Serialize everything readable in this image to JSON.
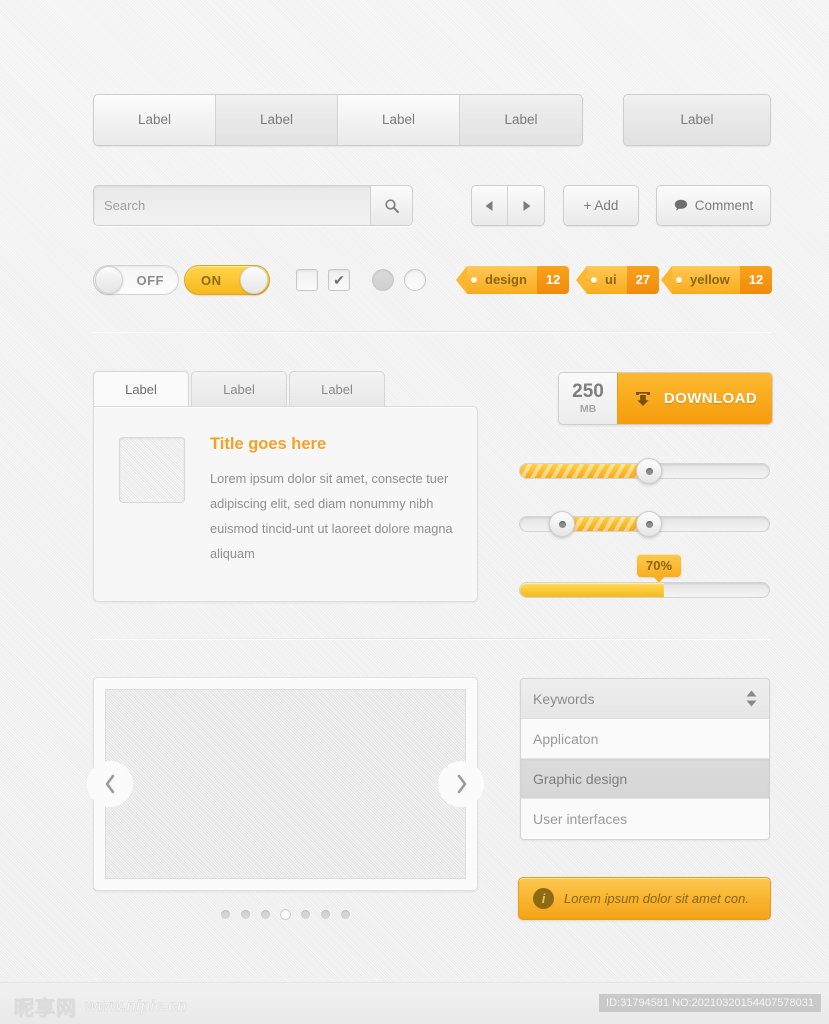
{
  "segmented": {
    "group_labels": [
      "Label",
      "Label",
      "Label",
      "Label"
    ],
    "single_label": "Label"
  },
  "search": {
    "placeholder": "Search",
    "value": "",
    "icon": "search-icon"
  },
  "toolbar": {
    "prev_icon": "triangle-left-icon",
    "next_icon": "triangle-right-icon",
    "add_label": "+ Add",
    "comment_label": "Comment",
    "comment_icon": "speech-bubble-icon"
  },
  "toggles": {
    "off_label": "OFF",
    "on_label": "ON"
  },
  "checkboxes": {
    "unchecked_mark": "",
    "checked_mark": "✔"
  },
  "tags": [
    {
      "label": "design",
      "count": "12"
    },
    {
      "label": "ui",
      "count": "27"
    },
    {
      "label": "yellow",
      "count": "12"
    }
  ],
  "tabs": [
    {
      "label": "Label",
      "active": true
    },
    {
      "label": "Label",
      "active": false
    },
    {
      "label": "Label",
      "active": false
    }
  ],
  "card": {
    "title": "Title goes here",
    "body": "Lorem ipsum dolor sit amet, consecte tuer adipiscing elit, sed diam nonummy nibh euismod tincid-unt ut laoreet dolore magna aliquam"
  },
  "download": {
    "size_number": "250",
    "size_unit": "MB",
    "button_label": "DOWNLOAD",
    "icon": "download-tray-icon"
  },
  "sliders": {
    "single": {
      "value_percent": 52
    },
    "range": {
      "low_percent": 17,
      "high_percent": 52
    },
    "progress": {
      "value_percent": 70,
      "bubble_label": "70%"
    }
  },
  "carousel": {
    "prev_icon": "chevron-left-icon",
    "next_icon": "chevron-right-icon",
    "dot_count": 7,
    "active_dot_index": 3
  },
  "list": {
    "header": "Keywords",
    "spinner_up_icon": "caret-up-icon",
    "spinner_down_icon": "caret-down-icon",
    "items": [
      {
        "label": "Applicaton",
        "selected": false
      },
      {
        "label": "Graphic design",
        "selected": true
      },
      {
        "label": "User interfaces",
        "selected": false
      }
    ]
  },
  "notice": {
    "icon_letter": "i",
    "message": "Lorem ipsum dolor sit amet con."
  },
  "footer": {
    "watermark_cn": "昵享网",
    "watermark_url": "www.nipic.cn",
    "id_text": "ID:31794581 NO:20210320154407578031"
  },
  "colors": {
    "accent": "#f5a81c",
    "accent_light": "#fdc74e",
    "accent_dark": "#8a6513",
    "text": "#8a8a8a",
    "background": "#efefef"
  }
}
